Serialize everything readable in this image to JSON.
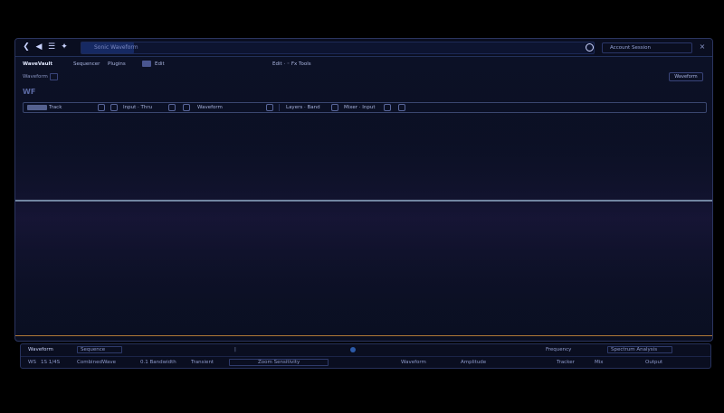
{
  "titlebar": {
    "address": "Sonic Waveform",
    "account": "Account   Session",
    "close_label": "×"
  },
  "menubar": {
    "brand": "WaveVault",
    "items": [
      "Sequencer",
      "Plugins",
      "Edit"
    ],
    "center_text": "Edit  ·  ◦  Fx   Tools"
  },
  "toolbar": {
    "left_label": "Waveform",
    "button_label": "Waveform"
  },
  "channel": {
    "label": "WF"
  },
  "params": {
    "fields": [
      "Track",
      "Input  ·  Thru",
      "Waveform",
      "Layers  ·  Band",
      "Mixer  ·  Input"
    ]
  },
  "bottom": {
    "row1": {
      "left": "Waveform",
      "tab": "Sequence",
      "middle_marker": "|",
      "right_a": "Frequency",
      "right_b": "Spectrum Analysis"
    },
    "row2": {
      "items": [
        "WS",
        "1S 1/4S",
        "CombinedWave",
        "0.1  Bandwidth",
        "Transient",
        "Zoom  Sensitivity",
        "Waveform",
        "Amplitude",
        "Tracker",
        "Mix",
        "Output"
      ]
    }
  },
  "colors": {
    "accent": "#2d62ff",
    "waveform_blue": "#6aa8ff",
    "waveform_magenta": "#c04dff",
    "spectrum_orange": "#f59a2a",
    "spectrum_green": "#8fe07a"
  },
  "icons": {
    "back": "back-arrow-icon",
    "forward": "forward-arrow-icon",
    "globe": "globe-icon",
    "close": "close-icon"
  }
}
